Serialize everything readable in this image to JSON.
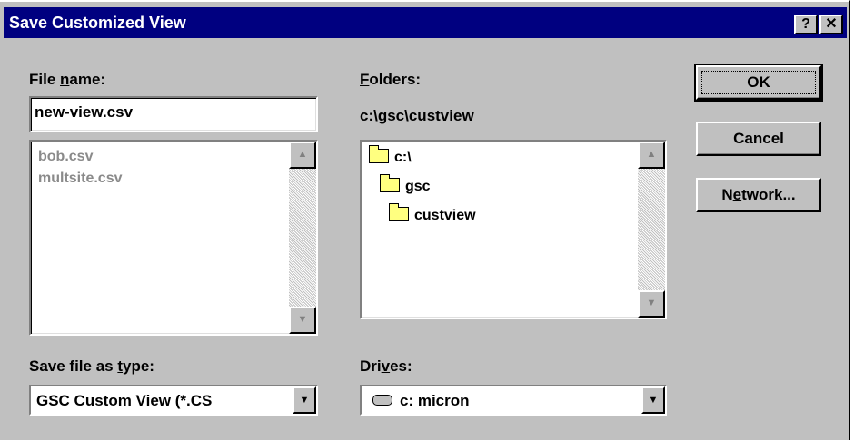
{
  "window": {
    "title": "Save Customized View",
    "help_button": "?",
    "close_button": "✕"
  },
  "file_name": {
    "label_pre": "File ",
    "label_accel": "n",
    "label_post": "ame:",
    "value": "new-view.csv",
    "files": [
      "bob.csv",
      "multsite.csv"
    ]
  },
  "folders": {
    "label_accel": "F",
    "label_post": "olders:",
    "current_path": "c:\\gsc\\custview",
    "items": [
      "c:\\",
      "gsc",
      "custview"
    ]
  },
  "buttons": {
    "ok": "OK",
    "cancel": "Cancel",
    "network_accel": "e",
    "network_pre": "N",
    "network_post": "twork..."
  },
  "save_type": {
    "label_pre": "Save file as ",
    "label_accel": "t",
    "label_post": "ype:",
    "value": "GSC Custom View (*.CS"
  },
  "drives": {
    "label_pre": "Dri",
    "label_accel": "v",
    "label_post": "es:",
    "value": "c: micron"
  },
  "icons": {
    "scroll_up": "scroll-up-arrow-icon",
    "scroll_down": "scroll-down-arrow-icon",
    "folder": "folder-icon",
    "drive": "hard-drive-icon",
    "dropdown": "dropdown-arrow-icon"
  }
}
